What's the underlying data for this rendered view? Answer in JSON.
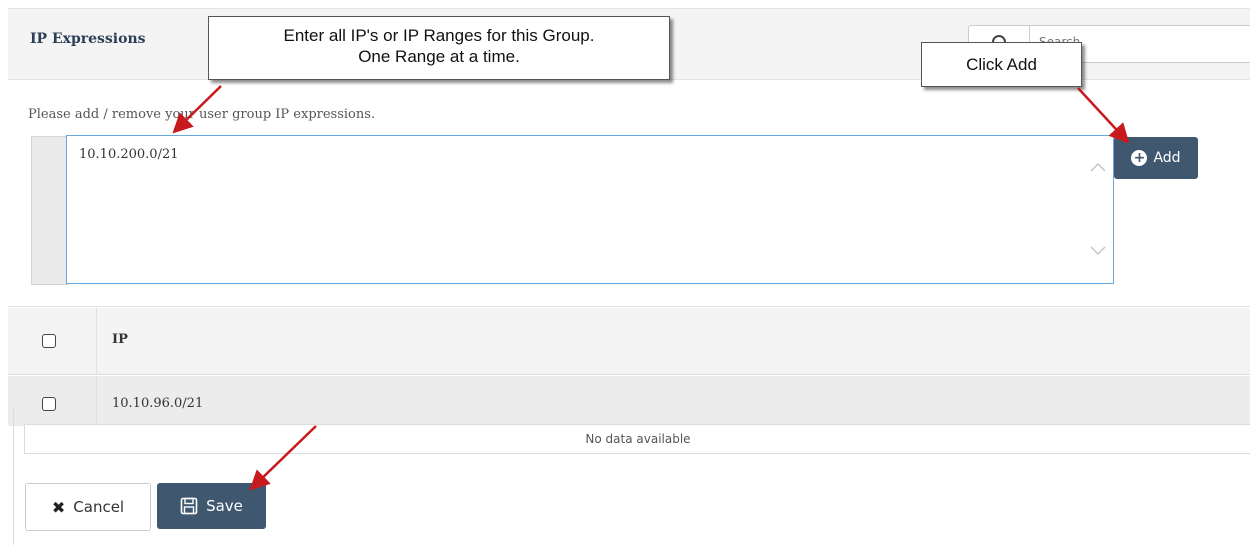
{
  "header": {
    "title": "IP Expressions"
  },
  "search": {
    "placeholder": "Search"
  },
  "form": {
    "instructions": "Please add / remove your user group IP expressions.",
    "ip_input_value": "10.10.200.0/21",
    "add_label": "Add"
  },
  "table": {
    "column_header": "IP",
    "rows": [
      {
        "ip": "10.10.96.0/21"
      }
    ],
    "no_data": "No data available"
  },
  "footer": {
    "cancel_label": "Cancel",
    "save_label": "Save"
  },
  "annotations": {
    "callout_1_line_1": "Enter all IP's or IP Ranges for this Group.",
    "callout_1_line_2": "One Range at a time.",
    "callout_2": "Click Add"
  },
  "colors": {
    "primary_button": "#3f5870",
    "input_focus_border": "#66a9e0",
    "arrow": "#c8191c"
  },
  "icons": [
    "search-icon",
    "plus-circle-icon",
    "chevron-up-icon",
    "chevron-down-icon",
    "checkbox-icon",
    "close-icon",
    "save-disk-icon"
  ]
}
